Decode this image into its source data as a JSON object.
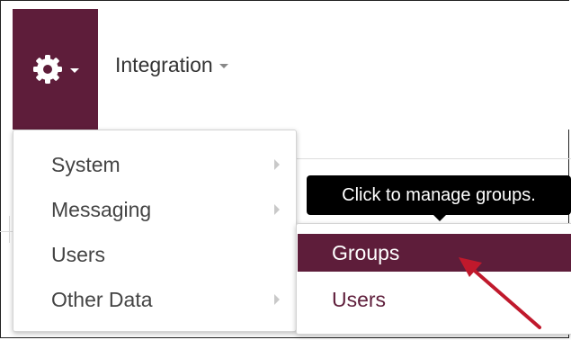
{
  "header": {
    "settings_menu": {
      "icon": "gear-icon",
      "caret_icon": "caret-down-icon"
    },
    "integration_label": "Integration"
  },
  "settings_menu": {
    "items": [
      {
        "label": "System",
        "has_submenu": true
      },
      {
        "label": "Messaging",
        "has_submenu": true
      },
      {
        "label": "Users",
        "has_submenu": false
      },
      {
        "label": "Other Data",
        "has_submenu": true
      }
    ]
  },
  "users_submenu": {
    "items": [
      {
        "label": "Groups",
        "active": true
      },
      {
        "label": "Users",
        "active": false
      }
    ]
  },
  "tooltip": {
    "text": "Click to manage groups."
  },
  "annotation": {
    "icon": "red-arrow-icon",
    "color": "#c0192c"
  },
  "colors": {
    "brand": "#5e1d3a",
    "menu_text": "#444444",
    "tooltip_bg": "#000000"
  }
}
